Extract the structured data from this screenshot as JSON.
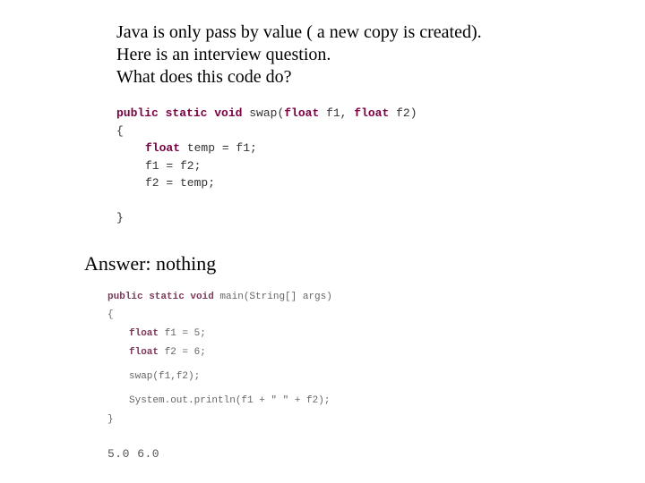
{
  "intro": {
    "line1": "Java is only pass by value ( a new copy is created).",
    "line2": "Here is an interview question.",
    "line3": "What does this code do?"
  },
  "code1": {
    "sig_pre": "public static void",
    "sig_name": " swap(",
    "sig_type": "float",
    "sig_mid1": " f1, ",
    "sig_mid2": " f2)",
    "open_brace": "{",
    "line_temp_kw": "float",
    "line_temp_rest": " temp = f1;",
    "line_assign1": "f1 = f2;",
    "line_assign2": "f2 = temp;",
    "close_brace": "}"
  },
  "answer_label": "Answer: nothing",
  "code2": {
    "sig_pre": "public static void",
    "sig_rest": " main(String[] args)",
    "open_brace": "{",
    "decl1_kw": "float",
    "decl1_rest": " f1 = 5;",
    "decl2_kw": "float",
    "decl2_rest": " f2 = 6;",
    "call": "swap(f1,f2);",
    "print": "System.out.println(f1 + \" \" + f2);",
    "close_brace": "}"
  },
  "output": "5.0 6.0"
}
